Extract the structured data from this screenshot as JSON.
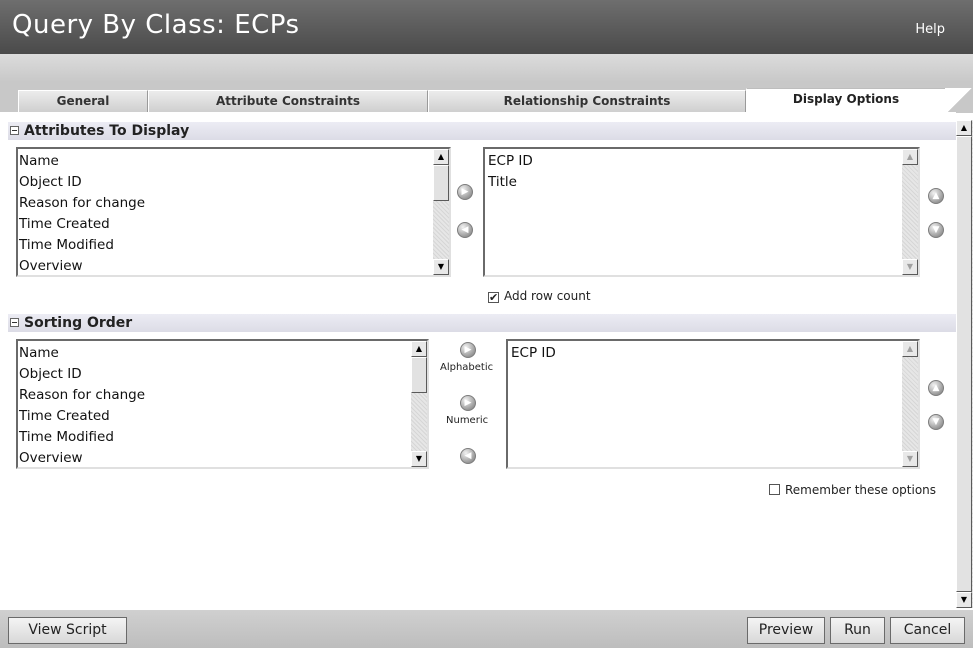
{
  "window": {
    "title": "Query By Class: ECPs",
    "help_label": "Help"
  },
  "tabs": [
    {
      "label": "General"
    },
    {
      "label": "Attribute Constraints"
    },
    {
      "label": "Relationship Constraints"
    },
    {
      "label": "Display Options",
      "active": true
    }
  ],
  "attributes_section": {
    "header": "Attributes To Display",
    "available": [
      "Name",
      "Object ID",
      "Reason for change",
      "Time Created",
      "Time Modified",
      "Overview"
    ],
    "selected": [
      "ECP ID",
      "Title"
    ],
    "add_row_count_label": "Add row count",
    "add_row_count_checked": true
  },
  "sorting_section": {
    "header": "Sorting Order",
    "available": [
      "Name",
      "Object ID",
      "Reason for change",
      "Time Created",
      "Time Modified",
      "Overview"
    ],
    "selected": [
      "ECP ID"
    ],
    "alphabetic_label": "Alphabetic",
    "numeric_label": "Numeric"
  },
  "remember_options_label": "Remember these options",
  "remember_options_checked": false,
  "footer": {
    "view_script_label": "View Script",
    "preview_label": "Preview",
    "run_label": "Run",
    "cancel_label": "Cancel"
  },
  "icons": {
    "add": "arrow-right-circle-icon",
    "remove": "arrow-left-circle-icon",
    "move_up": "arrow-up-circle-icon",
    "move_down": "arrow-down-circle-icon"
  },
  "colors": {
    "title_bar": "#555555",
    "section_header": "#e2e2ea",
    "tab_strip": "#c8c8c8"
  }
}
